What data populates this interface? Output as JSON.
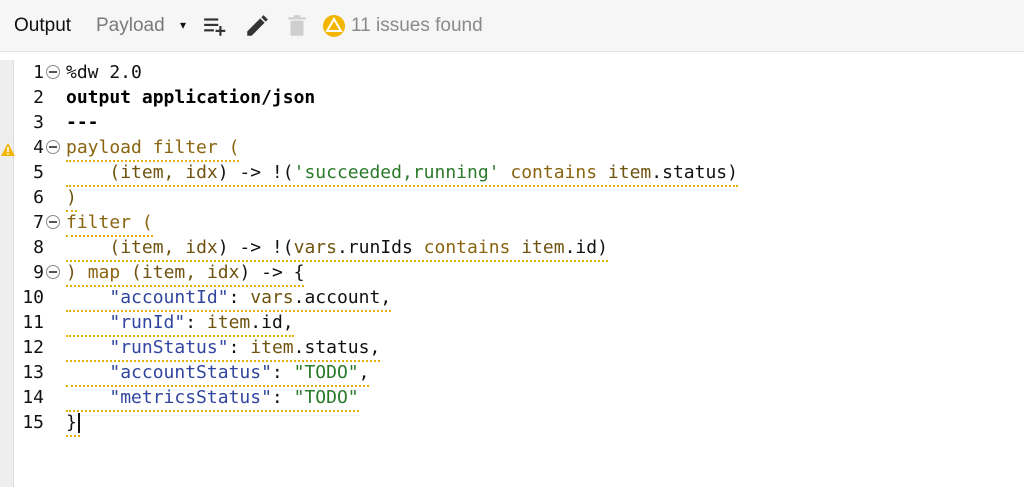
{
  "toolbar": {
    "title": "Output",
    "payload_select": "Payload",
    "caret": "▾",
    "issues_text": "11 issues found"
  },
  "icons": [
    "playlist-add-icon",
    "pencil-icon",
    "trash-icon",
    "warning-icon",
    "fold-icon"
  ],
  "colors": {
    "keyword": "#000000",
    "function": "#8a6410",
    "string": "#2a7a2a",
    "key": "#3045a0",
    "squiggle": "#e1b000",
    "warning": "#f2b600"
  },
  "editor": {
    "line_numbers": [
      "1",
      "2",
      "3",
      "4",
      "5",
      "6",
      "7",
      "8",
      "9",
      "10",
      "11",
      "12",
      "13",
      "14",
      "15"
    ],
    "lines": {
      "l1": "%dw 2.0",
      "l2": "output application/json",
      "l3": "---",
      "l4a": "payload",
      "l4b": " ",
      "l4c": "filter",
      "l4d": " (",
      "l5a": "    (",
      "l5b": "item",
      "l5c": ", ",
      "l5d": "idx",
      "l5e": ") -> !(",
      "l5f": "'succeeded,running'",
      "l5g": " ",
      "l5h": "contains",
      "l5i": " ",
      "l5j": "item",
      "l5k": ".status)",
      "l6": ")",
      "l7a": "filter",
      "l7b": " (",
      "l8a": "    (",
      "l8b": "item",
      "l8c": ", ",
      "l8d": "idx",
      "l8e": ") -> !(",
      "l8f": "vars",
      "l8g": ".runIds ",
      "l8h": "contains",
      "l8i": " ",
      "l8j": "item",
      "l8k": ".id)",
      "l9a": ") ",
      "l9b": "map",
      "l9c": " (",
      "l9d": "item",
      "l9e": ", ",
      "l9f": "idx",
      "l9g": ") -> {",
      "l10a": "    ",
      "l10b": "\"accountId\"",
      "l10c": ": ",
      "l10d": "vars",
      "l10e": ".account,",
      "l11a": "    ",
      "l11b": "\"runId\"",
      "l11c": ": ",
      "l11d": "item",
      "l11e": ".id,",
      "l12a": "    ",
      "l12b": "\"runStatus\"",
      "l12c": ": ",
      "l12d": "item",
      "l12e": ".status,",
      "l13a": "    ",
      "l13b": "\"accountStatus\"",
      "l13c": ": ",
      "l13d": "\"TODO\"",
      "l13e": ",",
      "l14a": "    ",
      "l14b": "\"metricsStatus\"",
      "l14c": ": ",
      "l14d": "\"TODO\"",
      "l15": "}"
    }
  }
}
